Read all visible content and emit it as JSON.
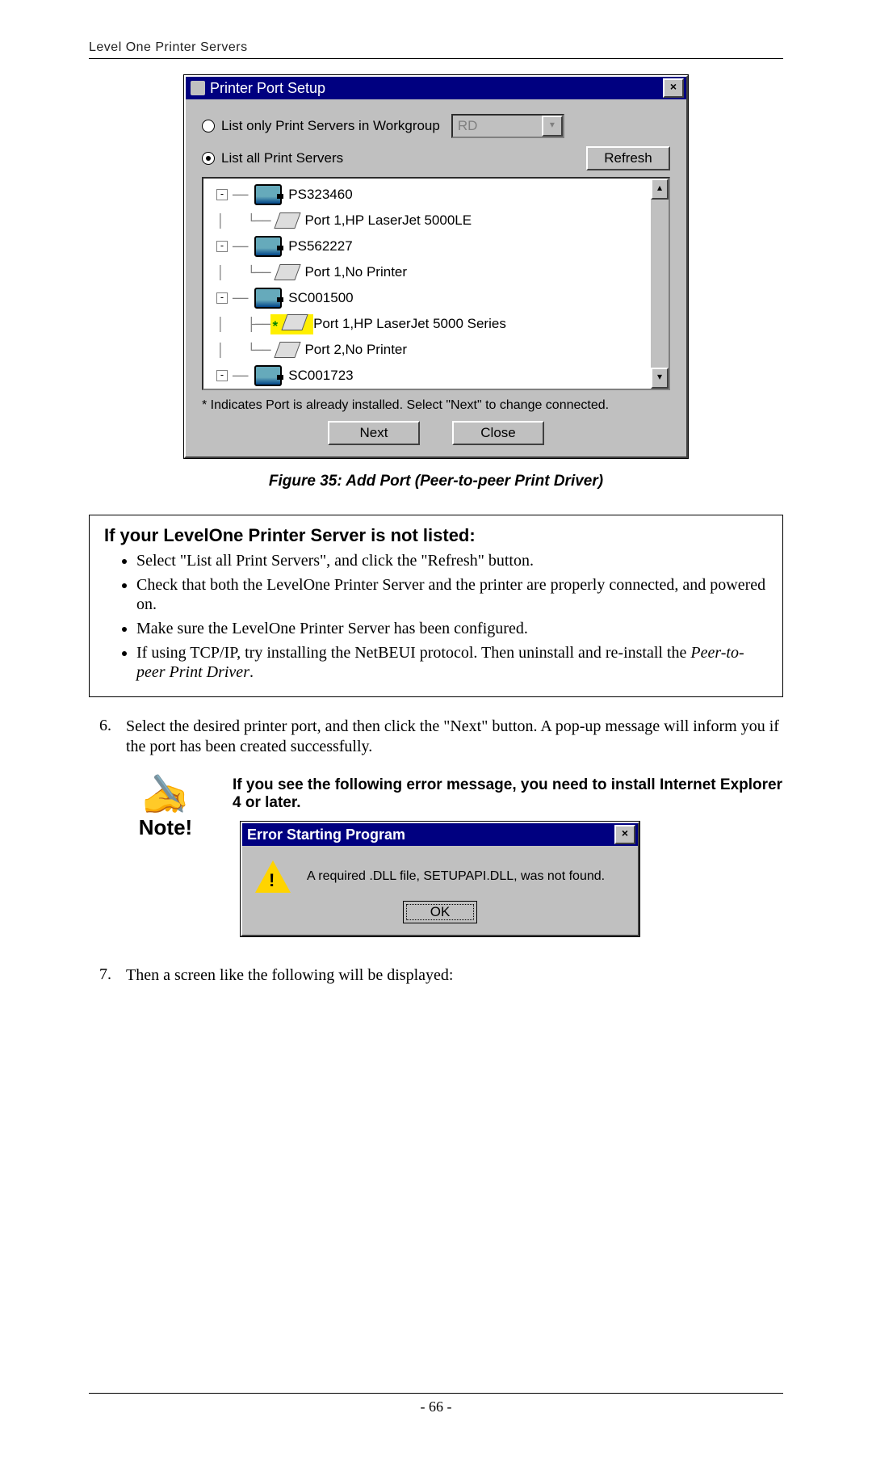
{
  "header": "Level One Printer Servers",
  "page_number": "- 66 -",
  "dialog1": {
    "title": "Printer Port Setup",
    "opt_workgroup": "List only Print Servers in Workgroup",
    "workgroup_value": "RD",
    "opt_all": "List all Print Servers",
    "refresh_btn": "Refresh",
    "tree": {
      "s0": "PS323460",
      "s0p1": "Port 1,HP LaserJet 5000LE",
      "s1": "PS562227",
      "s1p1": "Port 1,No Printer",
      "s2": "SC001500",
      "s2p1": "Port 1,HP LaserJet 5000 Series",
      "s2p2": "Port 2,No Printer",
      "s3": "SC001723"
    },
    "footnote": "* Indicates Port is already installed. Select \"Next\" to change connected.",
    "next_btn": "Next",
    "close_btn": "Close"
  },
  "figure_caption": "Figure 35: Add Port (Peer-to-peer Print Driver)",
  "infobox": {
    "title": "If your LevelOne Printer Server is not listed:",
    "b1": "Select \"List all Print Servers\", and click the \"Refresh\" button.",
    "b2": "Check that both the LevelOne Printer Server and the printer are properly connected, and powered on.",
    "b3": "Make sure the LevelOne Printer Server has been configured.",
    "b4_a": "If using TCP/IP, try installing the NetBEUI protocol. Then uninstall and re-install the ",
    "b4_i": "Peer-to-peer Print Driver",
    "b4_z": "."
  },
  "step6_num": "6.",
  "step6": "Select the desired printer port, and then click the \"Next\" button. A pop-up message will inform you if the port has been created successfully.",
  "note_label": "Note!",
  "note_text": "If you see the following error message, you need to install Internet Explorer 4 or later.",
  "error": {
    "title": "Error Starting Program",
    "msg": "A required .DLL file, SETUPAPI.DLL, was not found.",
    "ok": "OK"
  },
  "step7_num": "7.",
  "step7": "Then a screen like the following will be displayed:"
}
